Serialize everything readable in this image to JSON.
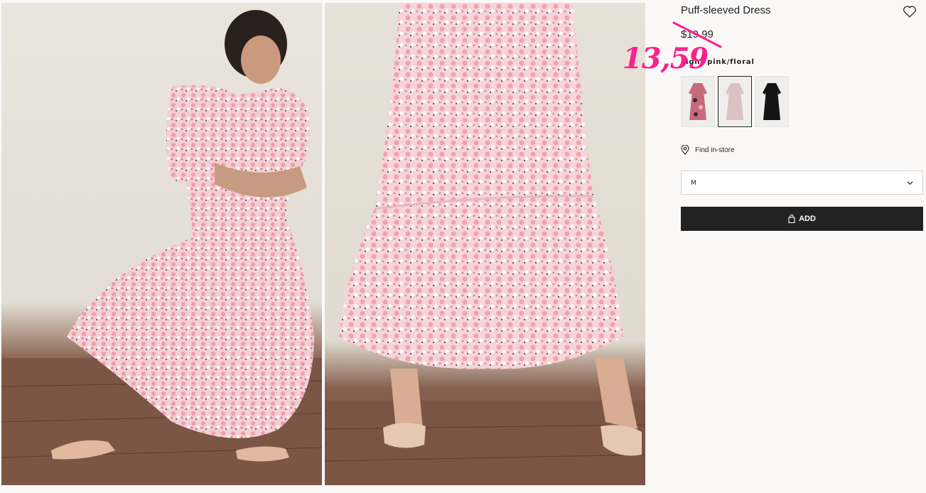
{
  "product": {
    "title": "Puff-sleeved Dress",
    "old_price": "$19.99",
    "new_price": "13,59",
    "color_label": "Light pink/floral"
  },
  "icons": {
    "favorite": "heart-outline-icon",
    "location": "map-pin-icon",
    "bag": "shopping-bag-icon",
    "chevron": "chevron-down-icon"
  },
  "swatches": [
    {
      "name": "dark pink floral",
      "selected": false
    },
    {
      "name": "light pink floral",
      "selected": true
    },
    {
      "name": "black",
      "selected": false
    }
  ],
  "store": {
    "find_label": "Find in-store"
  },
  "size_select": {
    "value": "M"
  },
  "add_button": {
    "label": "ADD"
  },
  "colors": {
    "accent_pink": "#ff1f8e",
    "button_bg": "#222222",
    "page_bg": "#faf9f8"
  }
}
